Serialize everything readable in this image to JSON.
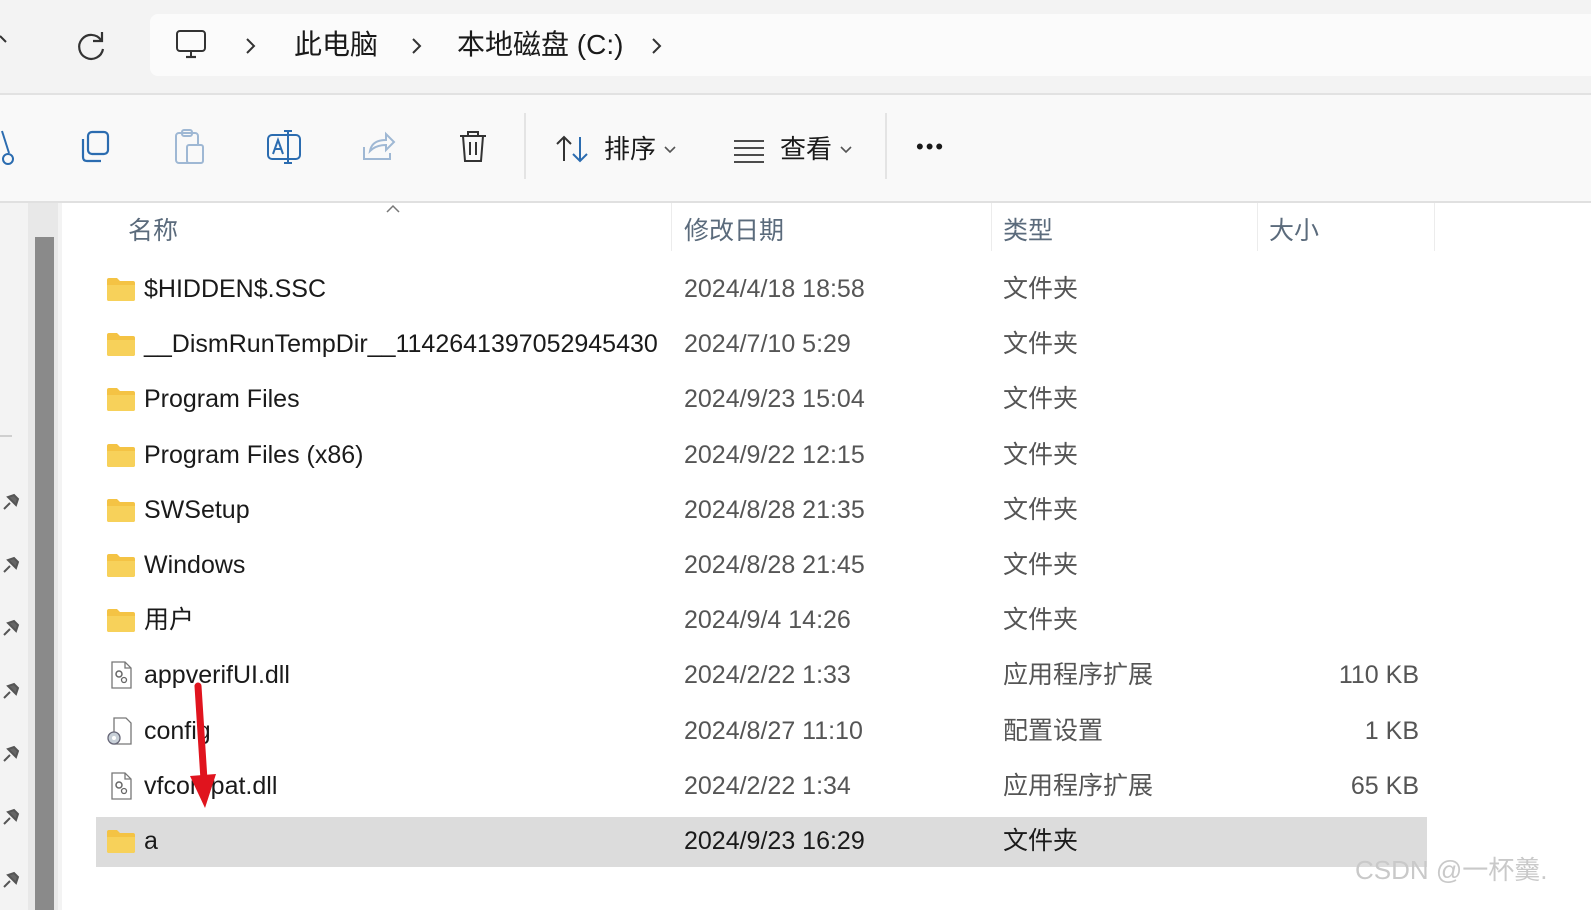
{
  "breadcrumb": {
    "items": [
      "此电脑",
      "本地磁盘 (C:)"
    ]
  },
  "toolbar": {
    "sort_label": "排序",
    "view_label": "查看",
    "more_label": "•••"
  },
  "columns": {
    "name": "名称",
    "date": "修改日期",
    "type": "类型",
    "size": "大小"
  },
  "files": [
    {
      "name": "$HIDDEN$.SSC",
      "date": "2024/4/18 18:58",
      "type": "文件夹",
      "size": "",
      "icon": "folder-icon"
    },
    {
      "name": "__DismRunTempDir__1142641397052945430",
      "date": "2024/7/10 5:29",
      "type": "文件夹",
      "size": "",
      "icon": "folder-icon"
    },
    {
      "name": "Program Files",
      "date": "2024/9/23 15:04",
      "type": "文件夹",
      "size": "",
      "icon": "folder-icon"
    },
    {
      "name": "Program Files (x86)",
      "date": "2024/9/22 12:15",
      "type": "文件夹",
      "size": "",
      "icon": "folder-icon"
    },
    {
      "name": "SWSetup",
      "date": "2024/8/28 21:35",
      "type": "文件夹",
      "size": "",
      "icon": "folder-icon"
    },
    {
      "name": "Windows",
      "date": "2024/8/28 21:45",
      "type": "文件夹",
      "size": "",
      "icon": "folder-icon"
    },
    {
      "name": "用户",
      "date": "2024/9/4 14:26",
      "type": "文件夹",
      "size": "",
      "icon": "folder-icon"
    },
    {
      "name": "appverifUI.dll",
      "date": "2024/2/22 1:33",
      "type": "应用程序扩展",
      "size": "110 KB",
      "icon": "dll-file-icon"
    },
    {
      "name": "config",
      "date": "2024/8/27 11:10",
      "type": "配置设置",
      "size": "1 KB",
      "icon": "config-file-icon"
    },
    {
      "name": "vfcompat.dll",
      "date": "2024/2/22 1:34",
      "type": "应用程序扩展",
      "size": "65 KB",
      "icon": "dll-file-icon"
    },
    {
      "name": "a",
      "date": "2024/9/23 16:29",
      "type": "文件夹",
      "size": "",
      "icon": "folder-icon",
      "selected": true
    }
  ],
  "watermark": "CSDN @一杯羹.",
  "colors": {
    "folder": "#f4c344",
    "selected_row": "#dcdcdc",
    "toolbar_blue": "#2b6cb0",
    "annotation_arrow": "#e0141e"
  }
}
